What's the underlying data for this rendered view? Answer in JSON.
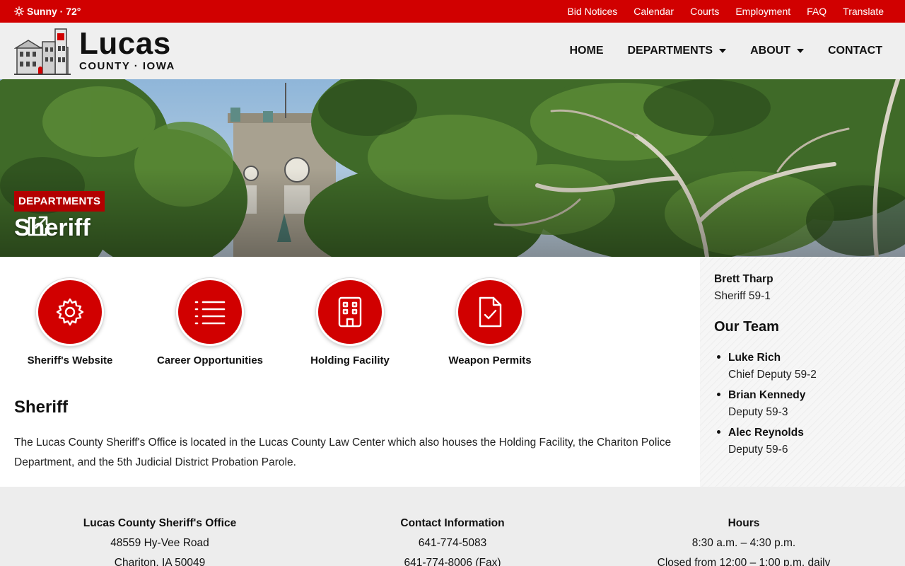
{
  "topbar": {
    "weather": "Sunny · 72°",
    "links": [
      "Bid Notices",
      "Calendar",
      "Courts",
      "Employment",
      "FAQ",
      "Translate"
    ]
  },
  "header": {
    "logo_name": "Lucas",
    "logo_sub": "COUNTY · IOWA",
    "nav": [
      {
        "label": "HOME",
        "dropdown": false
      },
      {
        "label": "DEPARTMENTS",
        "dropdown": true
      },
      {
        "label": "ABOUT",
        "dropdown": true
      },
      {
        "label": "CONTACT",
        "dropdown": false
      }
    ]
  },
  "hero": {
    "badge": "DEPARTMENTS",
    "title": "Sheriff"
  },
  "quick_links": [
    {
      "label": "Sheriff's Website",
      "icon": "gear-icon"
    },
    {
      "label": "Career Opportunities",
      "icon": "list-icon"
    },
    {
      "label": "Holding Facility",
      "icon": "building-icon"
    },
    {
      "label": "Weapon Permits",
      "icon": "document-check-icon"
    }
  ],
  "content": {
    "title": "Sheriff",
    "body": "The Lucas County Sheriff's Office is located in the Lucas County Law Center which also houses the Holding Facility, the Chariton Police Department, and the 5th Judicial District Probation Parole."
  },
  "sidebar": {
    "head_name": "Brett Tharp",
    "head_role": "Sheriff 59-1",
    "team_title": "Our Team",
    "team": [
      {
        "name": "Luke Rich",
        "role": "Chief Deputy 59-2"
      },
      {
        "name": "Brian Kennedy",
        "role": "Deputy 59-3"
      },
      {
        "name": "Alec Reynolds",
        "role": "Deputy 59-6"
      }
    ]
  },
  "footer": {
    "office": {
      "heading": "Lucas County Sheriff's Office",
      "line1": "48559 Hy-Vee Road",
      "line2": "Chariton, IA 50049"
    },
    "contact": {
      "heading": "Contact Information",
      "line1": "641-774-5083",
      "line2": "641-774-8006 (Fax)"
    },
    "hours": {
      "heading": "Hours",
      "line1": "8:30 a.m. – 4:30 p.m.",
      "line2": "Closed from 12:00 – 1:00 p.m. daily"
    }
  },
  "colors": {
    "brand_red": "#d10000",
    "badge_red": "#b30000",
    "header_bg": "#efefef",
    "footer_bg": "#ededed"
  }
}
